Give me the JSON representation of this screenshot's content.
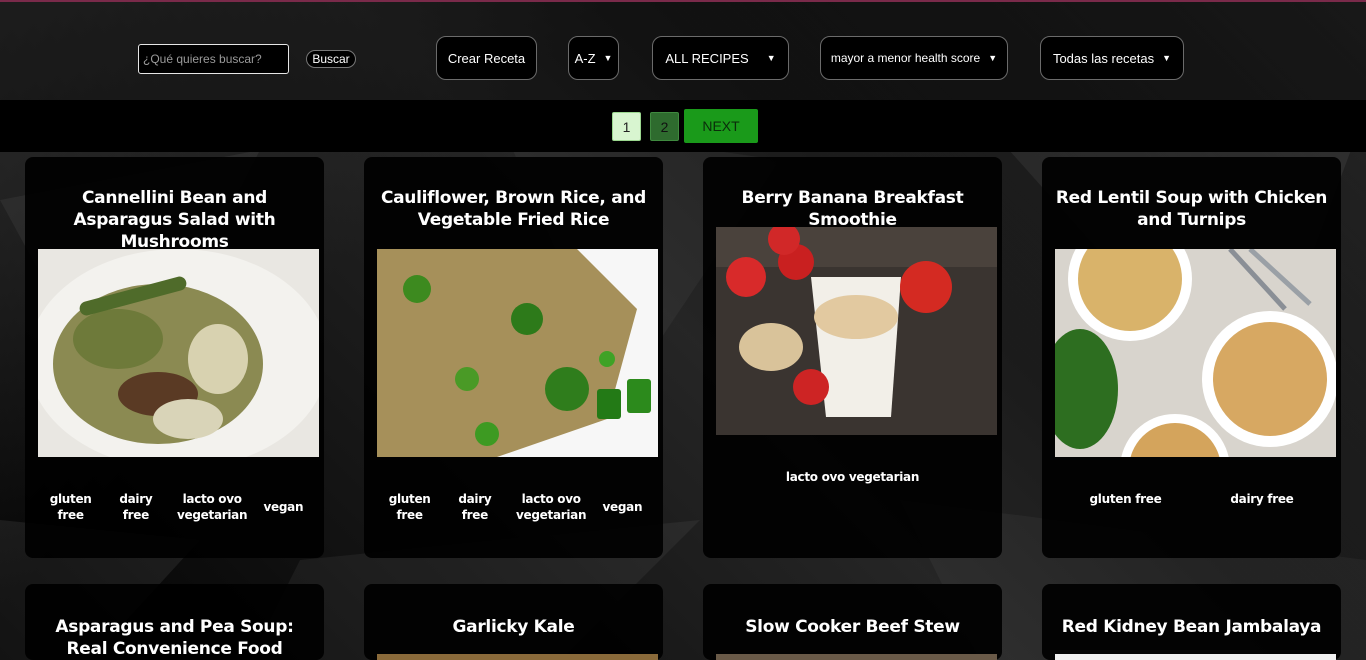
{
  "search": {
    "placeholder": "¿Qué quieres buscar?",
    "button_label": "Buscar"
  },
  "toolbar": {
    "create_label": "Crear Receta",
    "sort_alpha": "A-Z",
    "recipes_filter": "ALL RECIPES",
    "health_sort": "mayor a menor health score",
    "diet_filter": "Todas las recetas"
  },
  "pagination": {
    "pages": [
      "1",
      "2"
    ],
    "next_label": "NEXT"
  },
  "recipes": [
    {
      "title": "Cannellini Bean and Asparagus Salad with Mushrooms",
      "diets": [
        "gluten free",
        "dairy free",
        "lacto ovo vegetarian",
        "vegan"
      ]
    },
    {
      "title": "Cauliflower, Brown Rice, and Vegetable Fried Rice",
      "diets": [
        "gluten free",
        "dairy free",
        "lacto ovo vegetarian",
        "vegan"
      ]
    },
    {
      "title": "Berry Banana Breakfast Smoothie",
      "diets": [
        "lacto ovo vegetarian"
      ]
    },
    {
      "title": "Red Lentil Soup with Chicken and Turnips",
      "diets": [
        "gluten free",
        "dairy free"
      ]
    },
    {
      "title": "Asparagus and Pea Soup: Real Convenience Food",
      "diets": []
    },
    {
      "title": "Garlicky Kale",
      "diets": []
    },
    {
      "title": "Slow Cooker Beef Stew",
      "diets": []
    },
    {
      "title": "Red Kidney Bean Jambalaya",
      "diets": []
    }
  ],
  "colors": {
    "accent_green": "#1a9a1a",
    "page_active": "#d8f5d0",
    "page_inactive": "#2e6b2e"
  }
}
